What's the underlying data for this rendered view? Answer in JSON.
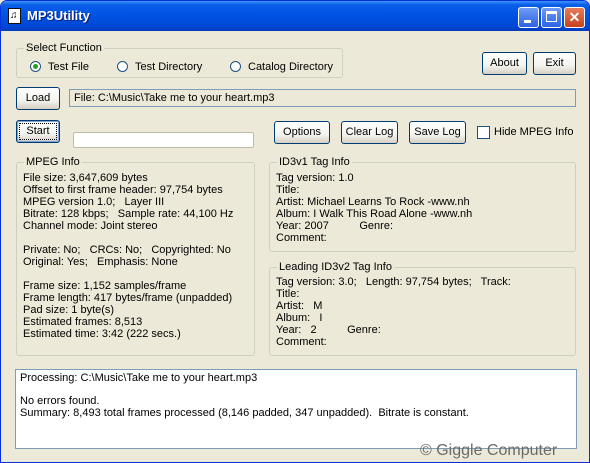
{
  "window": {
    "title": "MP3Utility",
    "close_glyph": "✕"
  },
  "select_function": {
    "legend": "Select Function",
    "options": [
      {
        "label": "Test File",
        "selected": true
      },
      {
        "label": "Test Directory",
        "selected": false
      },
      {
        "label": "Catalog Directory",
        "selected": false
      }
    ]
  },
  "buttons": {
    "about": "About",
    "exit": "Exit",
    "load": "Load",
    "start": "Start",
    "options": "Options",
    "clear_log": "Clear Log",
    "save_log": "Save Log"
  },
  "file_field": {
    "value": "File: C:\\Music\\Take me to your heart.mp3"
  },
  "hide_mpeg_info": {
    "label": "Hide MPEG Info",
    "checked": false
  },
  "progress": {
    "fraction": 0
  },
  "mpeg_info": {
    "legend": "MPEG Info",
    "lines": [
      "File size: 3,647,609 bytes",
      "Offset to first frame header: 97,754 bytes",
      "MPEG version 1.0;   Layer III",
      "Bitrate: 128 kbps;   Sample rate: 44,100 Hz",
      "Channel mode: Joint stereo",
      "",
      "Private: No;   CRCs: No;   Copyrighted: No",
      "Original: Yes;   Emphasis: None",
      "",
      "Frame size: 1,152 samples/frame",
      "Frame length: 417 bytes/frame (unpadded)",
      "Pad size: 1 byte(s)",
      "Estimated frames: 8,513",
      "Estimated time: 3:42 (222 secs.)"
    ]
  },
  "id3v1": {
    "legend": "ID3v1 Tag Info",
    "lines": [
      "Tag version: 1.0",
      "Title:",
      "Artist: Michael Learns To Rock -www.nh",
      "Album: I Walk This Road Alone -www.nh",
      "Year: 2007          Genre:",
      "Comment:"
    ]
  },
  "id3v2": {
    "legend": "Leading ID3v2 Tag Info",
    "lines": [
      "Tag version: 3.0;   Length: 97,754 bytes;   Track:",
      "Title:",
      "Artist:   M",
      "Album:   I",
      "Year:   2          Genre:",
      "Comment:"
    ]
  },
  "output_log": {
    "lines": [
      "Processing: C:\\Music\\Take me to your heart.mp3",
      "",
      "No errors found.",
      "Summary: 8,493 total frames processed (8,146 padded, 347 unpadded).  Bitrate is constant."
    ]
  },
  "copyright": "© Giggle Computer"
}
